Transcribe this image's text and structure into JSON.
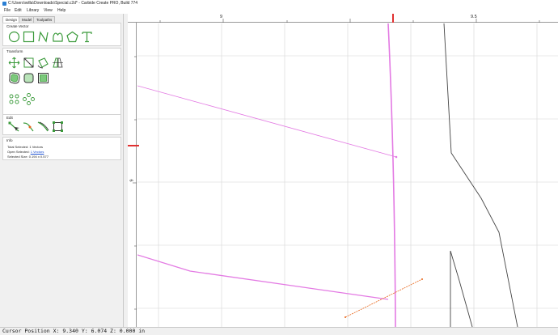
{
  "window": {
    "title": "C:\\Users\\willa\\Downloads\\Special.c2d* - Carbide Create PRO, Build 774"
  },
  "menu": [
    "File",
    "Edit",
    "Library",
    "View",
    "Help"
  ],
  "tabs": [
    "Design",
    "Model",
    "Toolpaths"
  ],
  "sections": {
    "create_vector": "Create Vector",
    "transform": "Transform",
    "edit": "Edit",
    "info": "Info"
  },
  "tools": {
    "create_vector": [
      "circle-icon",
      "rectangle-icon",
      "polyline-icon",
      "curve-icon",
      "polygon-icon",
      "text-icon"
    ],
    "transform_row1": [
      "move-icon",
      "scale-icon",
      "rotate-icon",
      "mirror-icon"
    ],
    "transform_row2": [
      "offset-icon",
      "fillet-icon",
      "boolean-icon"
    ],
    "transform_row3": [
      "array-icon",
      "circular-array-icon"
    ],
    "edit": [
      "node-edit-icon",
      "join-icon",
      "trim-icon",
      "bounding-box-icon"
    ]
  },
  "info": {
    "total_selected_label": "Total Selected:",
    "total_selected_value": "1 Vectors",
    "open_selected_label": "Open Selected:",
    "open_selected_value": "1 Vectors",
    "selected_size_label": "Selected Size:",
    "selected_size_value": "0.194 x 0.577"
  },
  "ruler": {
    "h_labels": [
      "9",
      "9.5"
    ],
    "v_labels": [
      "6"
    ]
  },
  "colors": {
    "accent_green": "#3a9a3a",
    "selected_vector": "#e37ae3",
    "cursor_marker": "#e03030",
    "toolpath_orange": "#e8661a",
    "vector_black": "#333333",
    "link": "#1a4fd1"
  },
  "status": {
    "text": "Cursor Position X: 9.340 Y: 6.074 Z: 0.000 in"
  }
}
